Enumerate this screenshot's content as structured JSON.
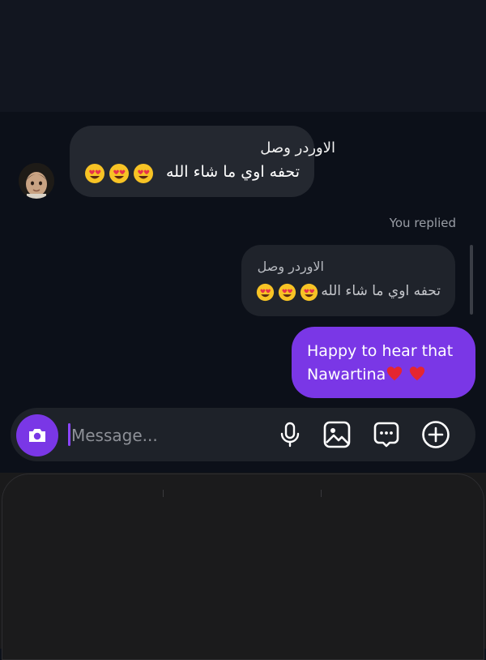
{
  "conversation": {
    "incoming": {
      "line1": "الاوردر وصل",
      "line2": "تحفه اوي ما شاء الله",
      "emoji": "heart-eyes",
      "emoji_count": 3
    },
    "reply_status": "You replied",
    "quoted": {
      "line1": "الاوردر وصل",
      "line2": "تحفه اوي ما شاء الله",
      "emoji_count": 3
    },
    "outgoing": {
      "line1": "Happy to hear that",
      "line2": "Nawartina"
    }
  },
  "composer": {
    "placeholder": "Message...",
    "value": "",
    "icons": [
      "camera-icon",
      "microphone-icon",
      "image-icon",
      "sticker-icon",
      "plus-icon"
    ]
  },
  "colors": {
    "accent": "#7a37e6",
    "background": "#0c1019",
    "bubble_incoming": "#242830",
    "bubble_quote": "#1f232b"
  }
}
